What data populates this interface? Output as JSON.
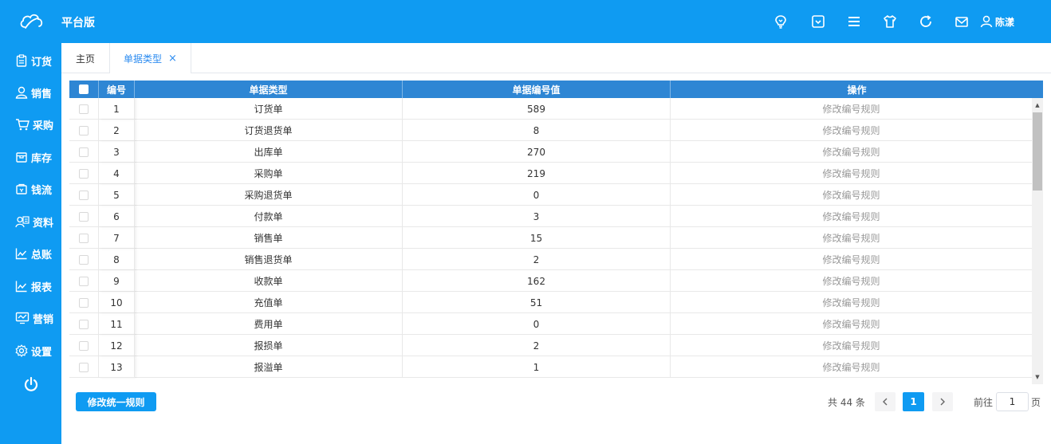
{
  "header": {
    "brand": "平台版",
    "user_name": "陈漾",
    "icons": [
      "bulb-icon",
      "dropdown-box-icon",
      "menu-icon",
      "shirt-icon",
      "refresh-icon",
      "mail-icon",
      "user-icon"
    ]
  },
  "sidebar": {
    "items": [
      {
        "label": "订货",
        "icon": "clipboard-icon"
      },
      {
        "label": "销售",
        "icon": "person-icon"
      },
      {
        "label": "采购",
        "icon": "cart-icon"
      },
      {
        "label": "库存",
        "icon": "box-icon"
      },
      {
        "label": "钱流",
        "icon": "wallet-icon"
      },
      {
        "label": "资料",
        "icon": "contact-card-icon"
      },
      {
        "label": "总账",
        "icon": "chart-line-icon"
      },
      {
        "label": "报表",
        "icon": "chart-line-icon"
      },
      {
        "label": "营销",
        "icon": "monitor-icon"
      },
      {
        "label": "设置",
        "icon": "gear-icon"
      }
    ],
    "power_icon": "power-icon"
  },
  "tabs": {
    "home": "主页",
    "active": "单据类型",
    "close": "×"
  },
  "table": {
    "columns": [
      "编号",
      "单据类型",
      "单据编号值",
      "操作"
    ],
    "rows": [
      {
        "no": "1",
        "type": "订货单",
        "value": "589",
        "action": "修改编号规则"
      },
      {
        "no": "2",
        "type": "订货退货单",
        "value": "8",
        "action": "修改编号规则"
      },
      {
        "no": "3",
        "type": "出库单",
        "value": "270",
        "action": "修改编号规则"
      },
      {
        "no": "4",
        "type": "采购单",
        "value": "219",
        "action": "修改编号规则"
      },
      {
        "no": "5",
        "type": "采购退货单",
        "value": "0",
        "action": "修改编号规则"
      },
      {
        "no": "6",
        "type": "付款单",
        "value": "3",
        "action": "修改编号规则"
      },
      {
        "no": "7",
        "type": "销售单",
        "value": "15",
        "action": "修改编号规则"
      },
      {
        "no": "8",
        "type": "销售退货单",
        "value": "2",
        "action": "修改编号规则"
      },
      {
        "no": "9",
        "type": "收款单",
        "value": "162",
        "action": "修改编号规则"
      },
      {
        "no": "10",
        "type": "充值单",
        "value": "51",
        "action": "修改编号规则"
      },
      {
        "no": "11",
        "type": "费用单",
        "value": "0",
        "action": "修改编号规则"
      },
      {
        "no": "12",
        "type": "报损单",
        "value": "2",
        "action": "修改编号规则"
      },
      {
        "no": "13",
        "type": "报溢单",
        "value": "1",
        "action": "修改编号规则"
      }
    ]
  },
  "footer": {
    "rule_button": "修改统一规则",
    "total": "共 44 条",
    "current_page": "1",
    "goto_label": "前往",
    "goto_value": "1",
    "page_unit": "页"
  },
  "colors": {
    "primary": "#0f9bf2",
    "table_header": "#2e86d4",
    "tab_active": "#2d8cf0"
  }
}
